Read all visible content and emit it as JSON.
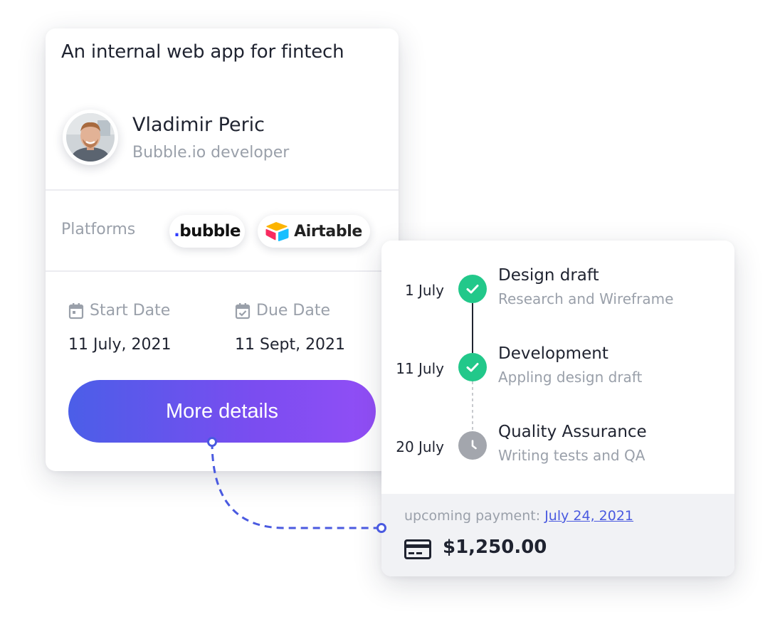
{
  "project": {
    "title": "An internal web app for fintech",
    "developer": {
      "name": "Vladimir Peric",
      "role": "Bubble.io developer"
    },
    "platforms_label": "Platforms",
    "platforms": [
      {
        "name": "bubble",
        "icon": "bubble-logo"
      },
      {
        "name": "Airtable",
        "icon": "airtable-logo"
      }
    ],
    "start_date": {
      "label": "Start Date",
      "value": "11 July, 2021",
      "icon": "calendar-icon"
    },
    "due_date": {
      "label": "Due Date",
      "value": "11 Sept, 2021",
      "icon": "calendar-check-icon"
    },
    "button_label": "More details"
  },
  "timeline": {
    "milestones": [
      {
        "date": "1 July",
        "title": "Design draft",
        "subtitle": "Research and Wireframe",
        "status": "done"
      },
      {
        "date": "11 July",
        "title": "Development",
        "subtitle": "Appling design draft",
        "status": "done"
      },
      {
        "date": "20 July",
        "title": "Quality Assurance",
        "subtitle": "Writing tests and QA",
        "status": "pending"
      }
    ],
    "payment": {
      "label": "upcoming payment:",
      "date": "July 24, 2021",
      "amount": "$1,250.00",
      "icon": "credit-card-icon"
    }
  },
  "colors": {
    "accent_start": "#4b5ee8",
    "accent_end": "#924ef6",
    "done": "#22c88a",
    "pending": "#a3a6ad",
    "connector": "#4a5ae0"
  }
}
